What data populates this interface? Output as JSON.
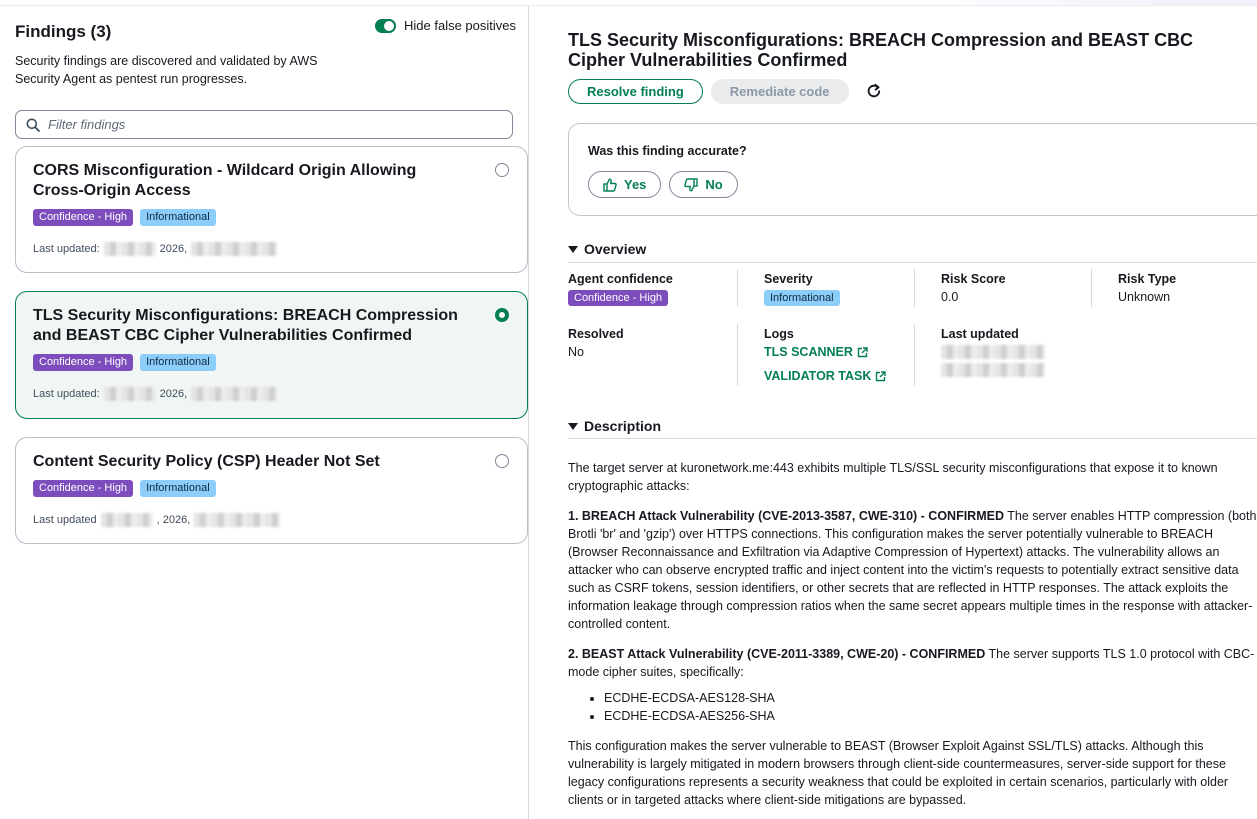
{
  "findings_panel": {
    "title": "Findings (3)",
    "hide_false_positives_label": "Hide false positives",
    "hide_false_positives_on": true,
    "subtitle": "Security findings are discovered and validated by AWS Security Agent as pentest run progresses.",
    "filter_placeholder": "Filter findings",
    "cards": [
      {
        "title": "CORS Misconfiguration - Wildcard Origin Allowing Cross-Origin Access",
        "confidence": "Confidence - High",
        "severity": "Informational",
        "updated_label": "Last updated:",
        "updated_year": "2026,",
        "selected": false
      },
      {
        "title": "TLS Security Misconfigurations: BREACH Compression and BEAST CBC Cipher Vulnerabilities Confirmed",
        "confidence": "Confidence - High",
        "severity": "Informational",
        "updated_label": "Last updated:",
        "updated_year": "2026,",
        "selected": true
      },
      {
        "title": "Content Security Policy (CSP) Header Not Set",
        "confidence": "Confidence - High",
        "severity": "Informational",
        "updated_label": "Last updated",
        "updated_year": ", 2026,",
        "selected": false
      }
    ]
  },
  "detail": {
    "title": "TLS Security Misconfigurations: BREACH Compression and BEAST CBC Cipher Vulnerabilities Confirmed",
    "resolve_button": "Resolve finding",
    "remediate_button": "Remediate code",
    "feedback": {
      "question": "Was this finding accurate?",
      "yes": "Yes",
      "no": "No"
    },
    "overview": {
      "heading": "Overview",
      "agent_confidence_label": "Agent confidence",
      "agent_confidence_value": "Confidence - High",
      "severity_label": "Severity",
      "severity_value": "Informational",
      "risk_score_label": "Risk Score",
      "risk_score_value": "0.0",
      "risk_type_label": "Risk Type",
      "risk_type_value": "Unknown",
      "resolved_label": "Resolved",
      "resolved_value": "No",
      "logs_label": "Logs",
      "log_link_1": "TLS SCANNER",
      "log_link_2": "VALIDATOR TASK",
      "last_updated_label": "Last updated"
    },
    "description": {
      "heading": "Description",
      "intro": "The target server at kuronetwork.me:443 exhibits multiple TLS/SSL security misconfigurations that expose it to known cryptographic attacks:",
      "item1_bold": "1. BREACH Attack Vulnerability (CVE-2013-3587, CWE-310) - CONFIRMED",
      "item1_text": " The server enables HTTP compression (both Brotli 'br' and 'gzip') over HTTPS connections. This configuration makes the server potentially vulnerable to BREACH (Browser Reconnaissance and Exfiltration via Adaptive Compression of Hypertext) attacks. The vulnerability allows an attacker who can observe encrypted traffic and inject content into the victim's requests to potentially extract sensitive data such as CSRF tokens, session identifiers, or other secrets that are reflected in HTTP responses. The attack exploits the information leakage through compression ratios when the same secret appears multiple times in the response with attacker-controlled content.",
      "item2_bold": "2. BEAST Attack Vulnerability (CVE-2011-3389, CWE-20) - CONFIRMED",
      "item2_text": " The server supports TLS 1.0 protocol with CBC-mode cipher suites, specifically:",
      "ciphers": [
        "ECDHE-ECDSA-AES128-SHA",
        "ECDHE-ECDSA-AES256-SHA"
      ],
      "outro": "This configuration makes the server vulnerable to BEAST (Browser Exploit Against SSL/TLS) attacks. Although this vulnerability is largely mitigated in modern browsers through client-side countermeasures, server-side support for these legacy configurations represents a security weakness that could be exploited in certain scenarios, particularly with older clients or in targeted attacks where client-side mitigations are bypassed."
    }
  },
  "colors": {
    "accent": "#037f51",
    "confidence_badge": "#7d4dbd",
    "info_badge": "#8ccdfa"
  }
}
